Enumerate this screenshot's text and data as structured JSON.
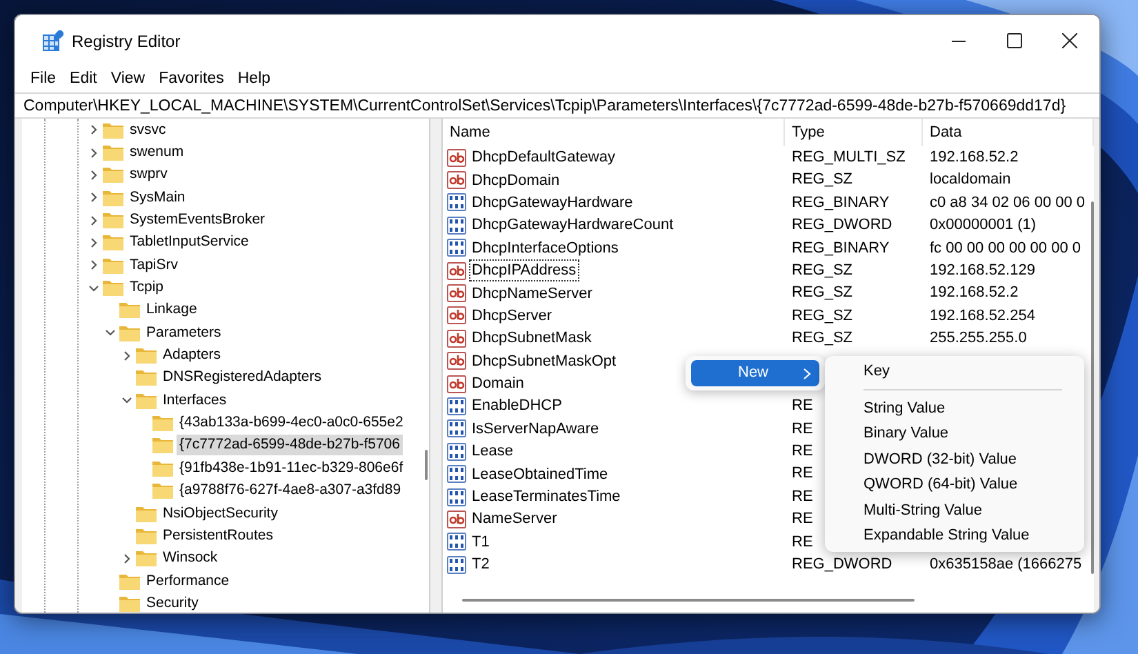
{
  "window": {
    "title": "Registry Editor"
  },
  "menu": [
    "File",
    "Edit",
    "View",
    "Favorites",
    "Help"
  ],
  "address": "Computer\\HKEY_LOCAL_MACHINE\\SYSTEM\\CurrentControlSet\\Services\\Tcpip\\Parameters\\Interfaces\\{7c7772ad-6599-48de-b27b-f570669dd17d}",
  "tree": [
    {
      "label": "svsvc",
      "expanded": false,
      "selected": false
    },
    {
      "label": "swenum",
      "expanded": false,
      "selected": false
    },
    {
      "label": "swprv",
      "expanded": false,
      "selected": false
    },
    {
      "label": "SysMain",
      "expanded": false,
      "selected": false
    },
    {
      "label": "SystemEventsBroker",
      "expanded": false,
      "selected": false
    },
    {
      "label": "TabletInputService",
      "expanded": false,
      "selected": false
    },
    {
      "label": "TapiSrv",
      "expanded": false,
      "selected": false
    },
    {
      "label": "Tcpip",
      "expanded": true,
      "selected": false,
      "children": [
        {
          "label": "Linkage",
          "selected": false
        },
        {
          "label": "Parameters",
          "expanded": true,
          "selected": false,
          "children": [
            {
              "label": "Adapters",
              "expanded": false,
              "selected": false
            },
            {
              "label": "DNSRegisteredAdapters",
              "selected": false
            },
            {
              "label": "Interfaces",
              "expanded": true,
              "selected": false,
              "children": [
                {
                  "label": "{43ab133a-b699-4ec0-a0c0-655e2",
                  "selected": false
                },
                {
                  "label": "{7c7772ad-6599-48de-b27b-f5706",
                  "selected": true
                },
                {
                  "label": "{91fb438e-1b91-11ec-b329-806e6f",
                  "selected": false
                },
                {
                  "label": "{a9788f76-627f-4ae8-a307-a3fd89",
                  "selected": false
                }
              ]
            },
            {
              "label": "NsiObjectSecurity",
              "selected": false
            },
            {
              "label": "PersistentRoutes",
              "selected": false
            },
            {
              "label": "Winsock",
              "expanded": false,
              "selected": false
            }
          ]
        },
        {
          "label": "Performance",
          "selected": false
        },
        {
          "label": "Security",
          "selected": false
        }
      ]
    }
  ],
  "values": {
    "columns": [
      "Name",
      "Type",
      "Data"
    ],
    "rows": [
      {
        "name": "DhcpDefaultGateway",
        "type": "REG_MULTI_SZ",
        "data": "192.168.52.2",
        "kind": "string",
        "focused": false
      },
      {
        "name": "DhcpDomain",
        "type": "REG_SZ",
        "data": "localdomain",
        "kind": "string",
        "focused": false
      },
      {
        "name": "DhcpGatewayHardware",
        "type": "REG_BINARY",
        "data": "c0 a8 34 02 06 00 00 0",
        "kind": "binary",
        "focused": false
      },
      {
        "name": "DhcpGatewayHardwareCount",
        "type": "REG_DWORD",
        "data": "0x00000001 (1)",
        "kind": "binary",
        "focused": false
      },
      {
        "name": "DhcpInterfaceOptions",
        "type": "REG_BINARY",
        "data": "fc 00 00 00 00 00 00 0",
        "kind": "binary",
        "focused": false
      },
      {
        "name": "DhcpIPAddress",
        "type": "REG_SZ",
        "data": "192.168.52.129",
        "kind": "string",
        "focused": true
      },
      {
        "name": "DhcpNameServer",
        "type": "REG_SZ",
        "data": "192.168.52.2",
        "kind": "string",
        "focused": false
      },
      {
        "name": "DhcpServer",
        "type": "REG_SZ",
        "data": "192.168.52.254",
        "kind": "string",
        "focused": false
      },
      {
        "name": "DhcpSubnetMask",
        "type": "REG_SZ",
        "data": "255.255.255.0",
        "kind": "string",
        "focused": false
      },
      {
        "name": "DhcpSubnetMaskOpt",
        "kind": "string",
        "focused": false
      },
      {
        "name": "Domain",
        "kind": "string",
        "focused": false
      },
      {
        "name": "EnableDHCP",
        "type": "RE",
        "kind": "binary",
        "focused": false
      },
      {
        "name": "IsServerNapAware",
        "type": "RE",
        "kind": "binary",
        "focused": false
      },
      {
        "name": "Lease",
        "type": "RE",
        "kind": "binary",
        "focused": false
      },
      {
        "name": "LeaseObtainedTime",
        "type": "RE",
        "kind": "binary",
        "focused": false
      },
      {
        "name": "LeaseTerminatesTime",
        "type": "RE",
        "kind": "binary",
        "focused": false
      },
      {
        "name": "NameServer",
        "type": "RE",
        "kind": "string",
        "focused": false
      },
      {
        "name": "T1",
        "type": "RE",
        "kind": "binary",
        "focused": false
      },
      {
        "name": "T2",
        "type": "REG_DWORD",
        "data": "0x635158ae (1666275",
        "kind": "binary",
        "focused": false
      }
    ]
  },
  "context_menu": {
    "items": [
      {
        "label": "New",
        "selected": true
      }
    ]
  },
  "submenu": {
    "items": [
      {
        "kind": "item",
        "label": "Key"
      },
      {
        "kind": "separator"
      },
      {
        "kind": "item",
        "label": "String Value"
      },
      {
        "kind": "item",
        "label": "Binary Value"
      },
      {
        "kind": "item",
        "label": "DWORD (32-bit) Value"
      },
      {
        "kind": "item",
        "label": "QWORD (64-bit) Value"
      },
      {
        "kind": "item",
        "label": "Multi-String Value"
      },
      {
        "kind": "item",
        "label": "Expandable String Value"
      }
    ]
  }
}
